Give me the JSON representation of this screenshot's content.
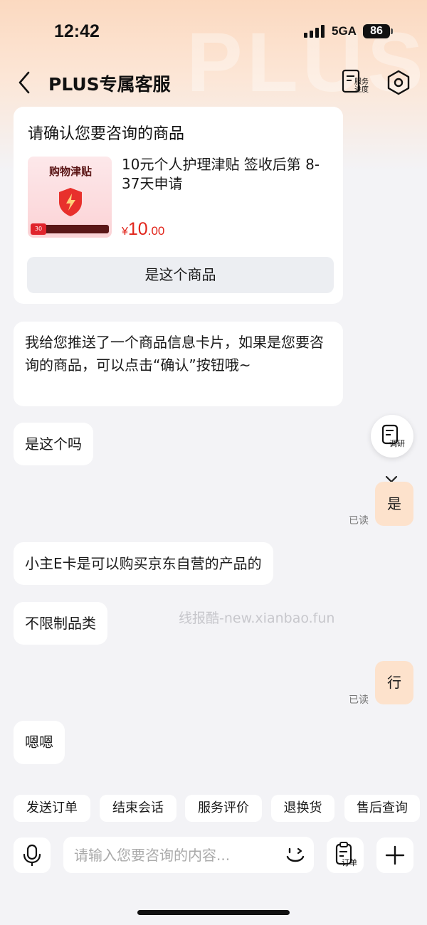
{
  "status_bar": {
    "time": "12:42",
    "network": "5GA",
    "battery": "86"
  },
  "header": {
    "title": "PLUS专属客服",
    "watermark": "PLUS",
    "progress_label": "服务进度"
  },
  "product_card": {
    "heading": "请确认您要咨询的商品",
    "image_label": "购物津贴",
    "image_badge": "30",
    "name": "10元个人护理津贴 签收后第 8-37天申请",
    "price_currency": "¥",
    "price_int": "10",
    "price_dec": ".00",
    "confirm_label": "是这个商品"
  },
  "messages": [
    {
      "side": "left",
      "text": "我给您推送了一个商品信息卡片，如果是您要咨询的商品，可以点击“确认”按钮哦~"
    },
    {
      "side": "left",
      "text": "是这个吗"
    },
    {
      "side": "right",
      "text": "是",
      "status": "已读"
    },
    {
      "side": "left",
      "text": "小主E卡是可以购买京东自营的产品的"
    },
    {
      "side": "left",
      "text": "不限制品类"
    },
    {
      "side": "right",
      "text": "行",
      "status": "已读"
    },
    {
      "side": "left",
      "text": "嗯嗯"
    }
  ],
  "survey_label": "调研",
  "watermark_text": "线报酷-new.xianbao.fun",
  "quick_replies": [
    "发送订单",
    "结束会话",
    "服务评价",
    "退换货",
    "售后查询"
  ],
  "input": {
    "placeholder": "请输入您要咨询的内容..."
  },
  "order_label": "订单"
}
